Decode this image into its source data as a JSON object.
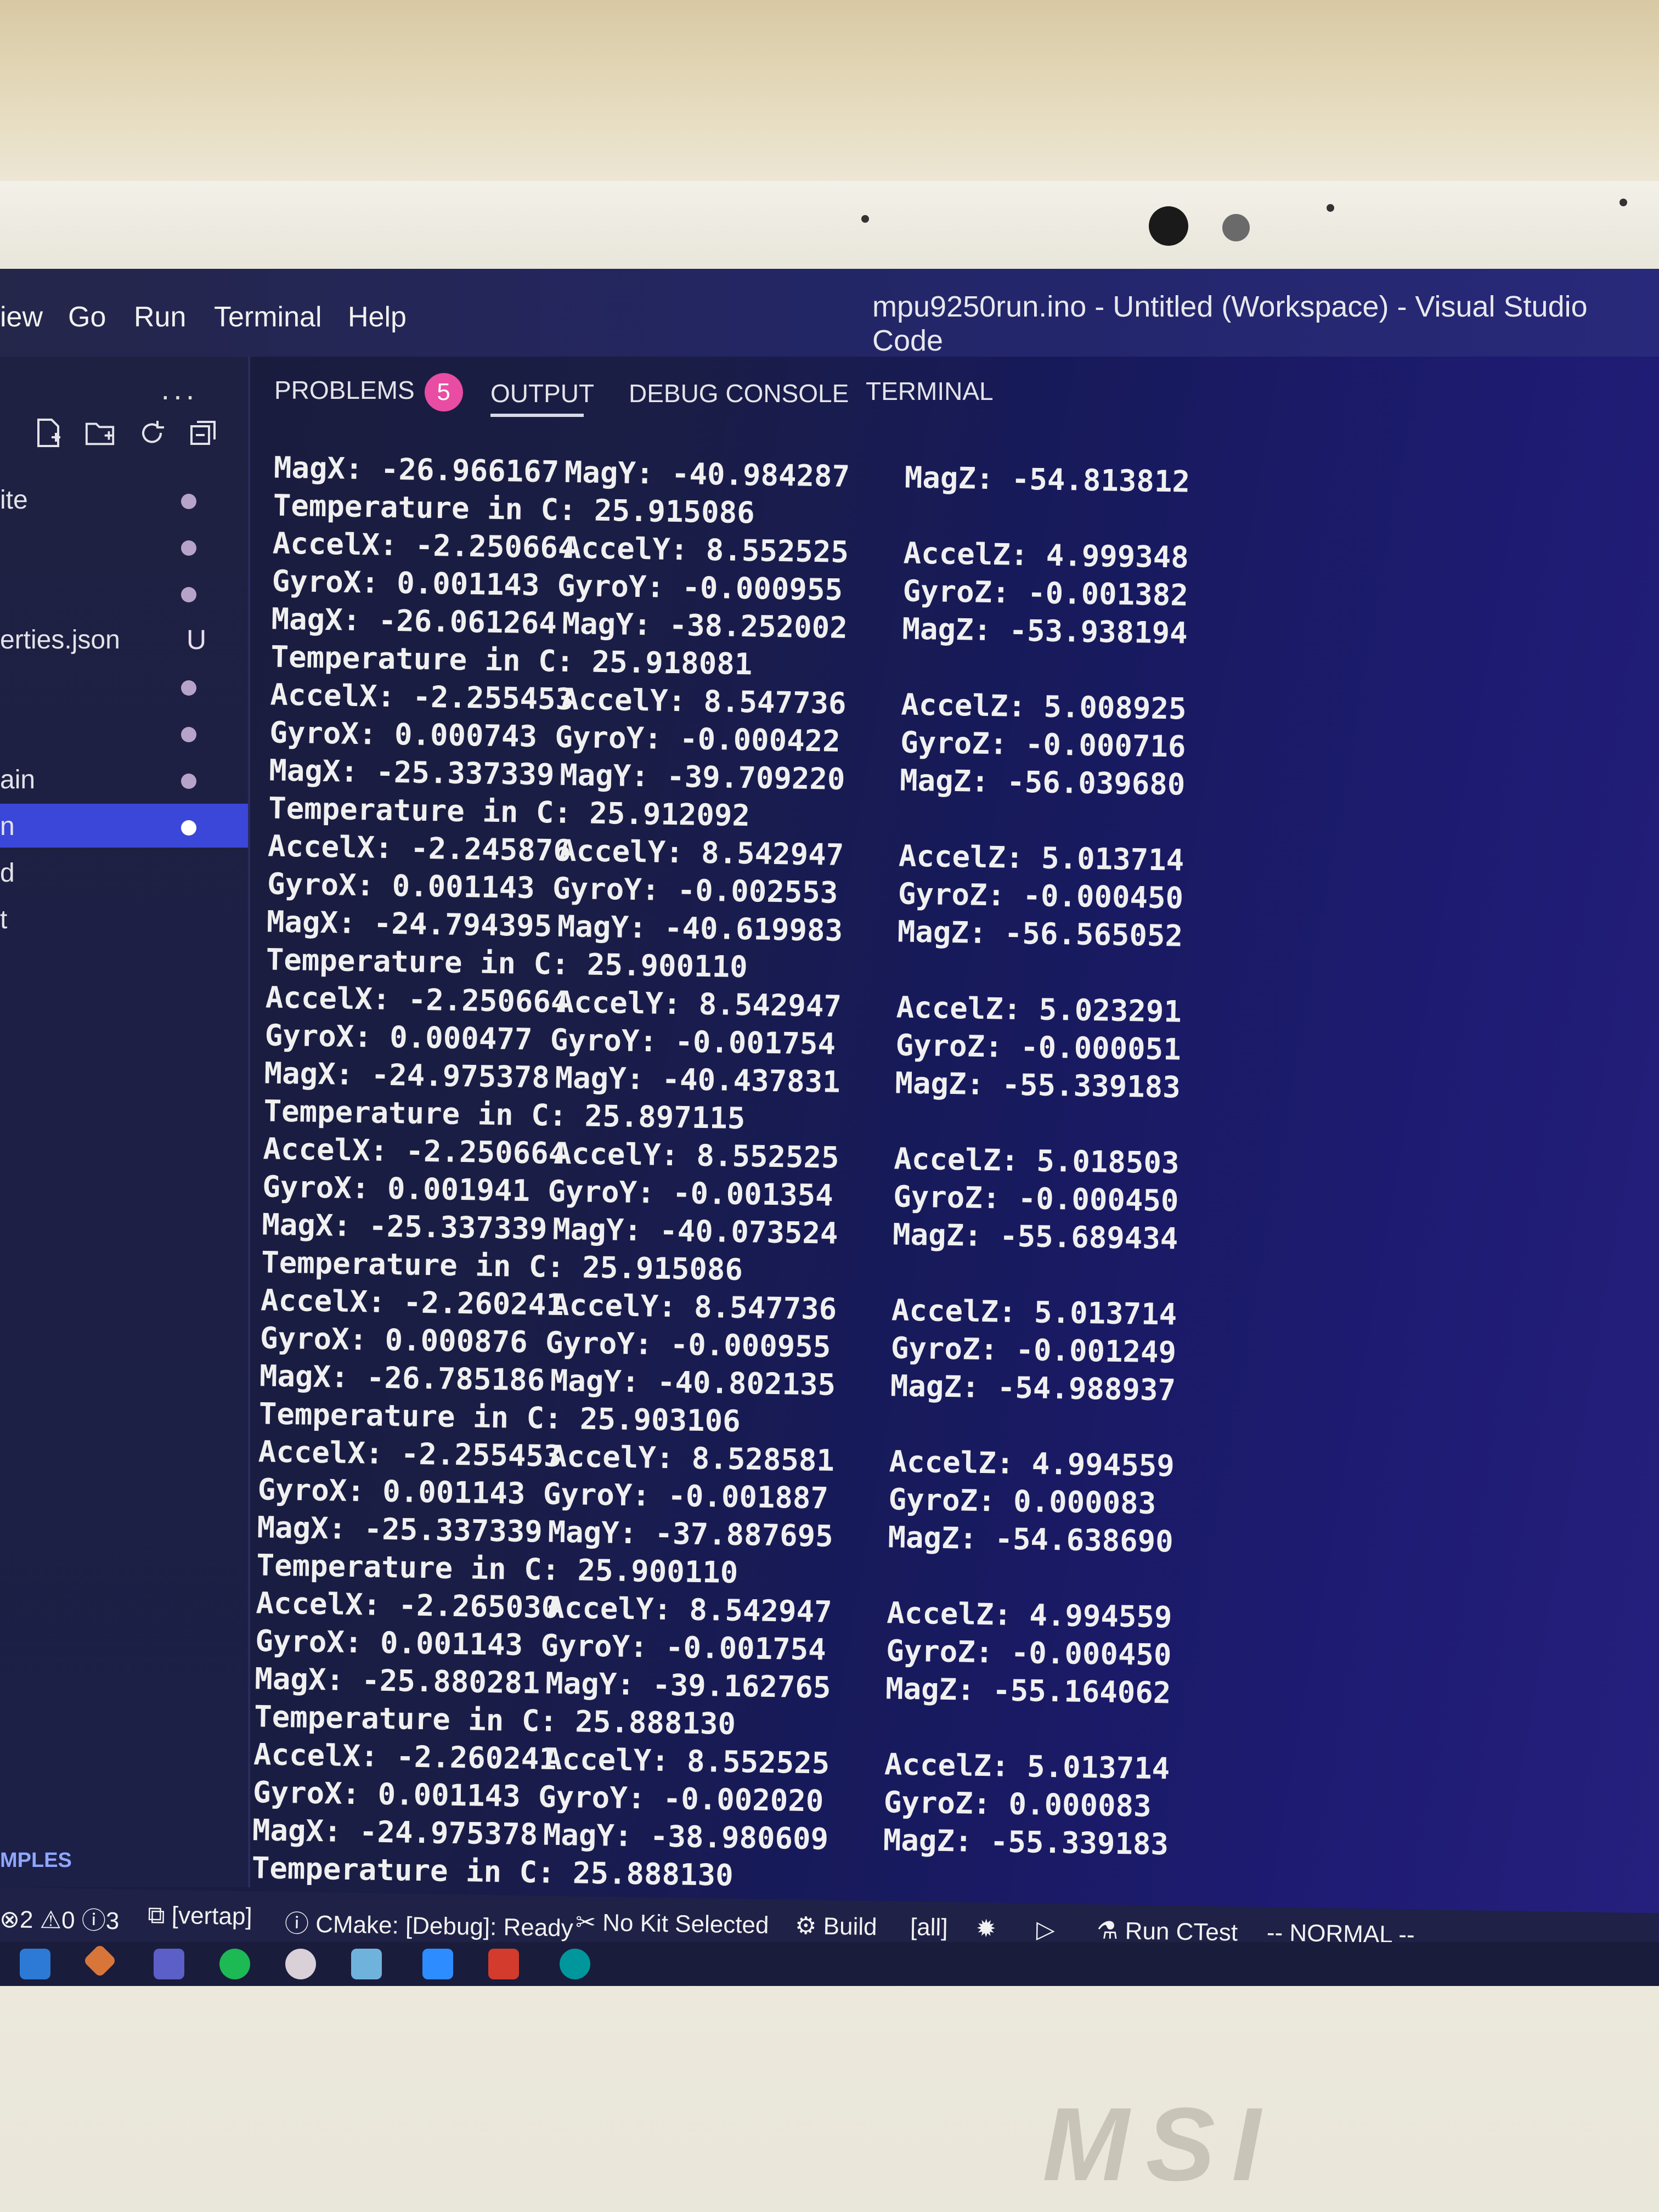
{
  "menu": {
    "items": [
      "iew",
      "Go",
      "Run",
      "Terminal",
      "Help"
    ],
    "window_title": "mpu9250run.ino - Untitled (Workspace) - Visual Studio Code"
  },
  "sidebar": {
    "more": "···",
    "files": [
      {
        "name": "ite",
        "status": "dot"
      },
      {
        "name": "",
        "status": "dot"
      },
      {
        "name": "",
        "status": "dot"
      },
      {
        "name": "erties.json",
        "status": "U"
      },
      {
        "name": "",
        "status": "dot"
      },
      {
        "name": "",
        "status": "dot"
      },
      {
        "name": "ain",
        "status": "dot"
      },
      {
        "name": "n",
        "status": "dot",
        "selected": true
      },
      {
        "name": "d",
        "status": ""
      },
      {
        "name": "t",
        "status": ""
      }
    ],
    "section": "MPLES"
  },
  "panel": {
    "tabs": [
      "PROBLEMS",
      "OUTPUT",
      "DEBUG CONSOLE",
      "TERMINAL"
    ],
    "problems_count": "5",
    "active": "OUTPUT"
  },
  "output": {
    "lines": [
      [
        "MagX: -26.966167",
        "MagY: -40.984287",
        "MagZ: -54.813812"
      ],
      [
        "Temperature in C: 25.915086"
      ],
      [
        "AccelX: -2.250664",
        "AccelY: 8.552525",
        "AccelZ: 4.999348"
      ],
      [
        "GyroX: 0.001143 GyroY: -0.000955",
        "",
        "GyroZ: -0.001382"
      ],
      [
        "MagX: -26.061264",
        "MagY: -38.252002",
        "MagZ: -53.938194"
      ],
      [
        "Temperature in C: 25.918081"
      ],
      [
        "AccelX: -2.255453",
        "AccelY: 8.547736",
        "AccelZ: 5.008925"
      ],
      [
        "GyroX: 0.000743 GyroY: -0.000422",
        "",
        "GyroZ: -0.000716"
      ],
      [
        "MagX: -25.337339",
        "MagY: -39.709220",
        "MagZ: -56.039680"
      ],
      [
        "Temperature in C: 25.912092"
      ],
      [
        "AccelX: -2.245876",
        "AccelY: 8.542947",
        "AccelZ: 5.013714"
      ],
      [
        "GyroX: 0.001143 GyroY: -0.002553",
        "",
        "GyroZ: -0.000450"
      ],
      [
        "MagX: -24.794395",
        "MagY: -40.619983",
        "MagZ: -56.565052"
      ],
      [
        "Temperature in C: 25.900110"
      ],
      [
        "AccelX: -2.250664",
        "AccelY: 8.542947",
        "AccelZ: 5.023291"
      ],
      [
        "GyroX: 0.000477 GyroY: -0.001754",
        "",
        "GyroZ: -0.000051"
      ],
      [
        "MagX: -24.975378",
        "MagY: -40.437831",
        "MagZ: -55.339183"
      ],
      [
        "Temperature in C: 25.897115"
      ],
      [
        "AccelX: -2.250664",
        "AccelY: 8.552525",
        "AccelZ: 5.018503"
      ],
      [
        "GyroX: 0.001941 GyroY: -0.001354",
        "",
        "GyroZ: -0.000450"
      ],
      [
        "MagX: -25.337339",
        "MagY: -40.073524",
        "MagZ: -55.689434"
      ],
      [
        "Temperature in C: 25.915086"
      ],
      [
        "AccelX: -2.260241",
        "AccelY: 8.547736",
        "AccelZ: 5.013714"
      ],
      [
        "GyroX: 0.000876 GyroY: -0.000955",
        "",
        "GyroZ: -0.001249"
      ],
      [
        "MagX: -26.785186",
        "MagY: -40.802135",
        "MagZ: -54.988937"
      ],
      [
        "Temperature in C: 25.903106"
      ],
      [
        "AccelX: -2.255453",
        "AccelY: 8.528581",
        "AccelZ: 4.994559"
      ],
      [
        "GyroX: 0.001143 GyroY: -0.001887",
        "",
        "GyroZ: 0.000083"
      ],
      [
        "MagX: -25.337339",
        "MagY: -37.887695",
        "MagZ: -54.638690"
      ],
      [
        "Temperature in C: 25.900110"
      ],
      [
        "AccelX: -2.265030",
        "AccelY: 8.542947",
        "AccelZ: 4.994559"
      ],
      [
        "GyroX: 0.001143 GyroY: -0.001754",
        "",
        "GyroZ: -0.000450"
      ],
      [
        "MagX: -25.880281",
        "MagY: -39.162765",
        "MagZ: -55.164062"
      ],
      [
        "Temperature in C: 25.888130"
      ],
      [
        "AccelX: -2.260241",
        "AccelY: 8.552525",
        "AccelZ: 5.013714"
      ],
      [
        "GyroX: 0.001143 GyroY: -0.002020",
        "",
        "GyroZ: 0.000083"
      ],
      [
        "MagX: -24.975378",
        "MagY: -38.980609",
        "MagZ: -55.339183"
      ],
      [
        "Temperature in C: 25.888130"
      ]
    ]
  },
  "statusbar": {
    "problems": "2",
    "warnings": "0",
    "info": "3",
    "branch": "[vertap]",
    "cmake": "CMake: [Debug]: Ready",
    "kit": "No Kit Selected",
    "build": "Build",
    "target": "[all]",
    "ctest": "Run CTest",
    "mode": "-- NORMAL --"
  },
  "taskbar": {
    "icons": [
      "vscode-icon",
      "git-icon",
      "teams-icon",
      "spotify-icon",
      "app-icon",
      "folder-icon",
      "zoom-icon",
      "solidworks-icon",
      "arduino-icon"
    ]
  },
  "brand": "MSI",
  "colors": {
    "accent": "#3a47d8",
    "badge": "#e94ca3",
    "background": "#1b1d4a"
  }
}
